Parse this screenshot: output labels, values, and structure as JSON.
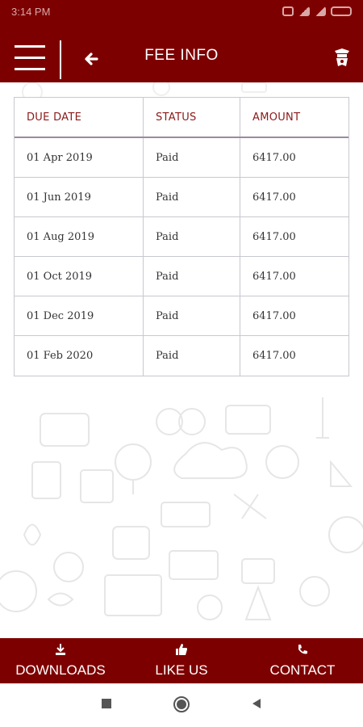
{
  "status_bar": {
    "time": "3:14 PM",
    "icons": [
      "alarm-icon",
      "signal-icon",
      "wifi-icon",
      "battery-icon"
    ]
  },
  "app_bar": {
    "title": "FEE INFO",
    "menu_icon": "hamburger-icon",
    "back_icon": "back-arrow-icon",
    "logo_icon": "school-logo-icon"
  },
  "fee_table": {
    "headers": [
      "DUE DATE",
      "STATUS",
      "AMOUNT"
    ],
    "rows": [
      [
        "01 Apr 2019",
        "Paid",
        "6417.00"
      ],
      [
        "01 Jun 2019",
        "Paid",
        "6417.00"
      ],
      [
        "01 Aug 2019",
        "Paid",
        "6417.00"
      ],
      [
        "01 Oct 2019",
        "Paid",
        "6417.00"
      ],
      [
        "01 Dec 2019",
        "Paid",
        "6417.00"
      ],
      [
        "01 Feb 2020",
        "Paid",
        "6417.00"
      ]
    ]
  },
  "bottom_nav": {
    "downloads": {
      "label": "DOWNLOADS",
      "icon": "download-icon"
    },
    "like_us": {
      "label": "LIKE US",
      "icon": "thumbs-up-icon"
    },
    "contact": {
      "label": "CONTACT",
      "icon": "phone-icon"
    }
  },
  "system_nav": [
    "recents-icon",
    "home-icon",
    "back-triangle-icon"
  ],
  "colors": {
    "primary": "#7d0000",
    "header_text": "#8b1a1a",
    "text": "#333333"
  }
}
